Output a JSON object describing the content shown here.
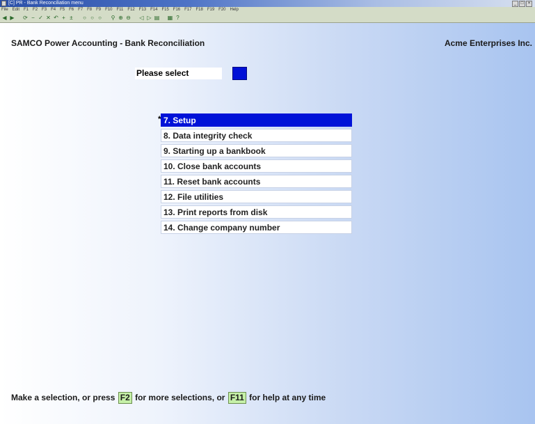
{
  "window": {
    "title": "[C] PR - Bank Reconciliation menu"
  },
  "menubar": {
    "items": [
      "File",
      "Edit",
      "F1",
      "F2",
      "F3",
      "F4",
      "F5",
      "F6",
      "F7",
      "F8",
      "F9",
      "F10",
      "F11",
      "F12",
      "F13",
      "F14",
      "F15",
      "F16",
      "F17",
      "F18",
      "F19",
      "F20",
      "Help"
    ]
  },
  "app": {
    "title": "SAMCO Power Accounting - Bank Reconciliation",
    "company": "Acme Enterprises Inc."
  },
  "prompt": {
    "label": "Please select",
    "value": ""
  },
  "menu": {
    "marker": "*",
    "items": [
      {
        "label": "7. Setup",
        "selected": true
      },
      {
        "label": "8. Data integrity check",
        "selected": false
      },
      {
        "label": "9. Starting up a bankbook",
        "selected": false
      },
      {
        "label": "10. Close bank accounts",
        "selected": false
      },
      {
        "label": "11. Reset bank accounts",
        "selected": false
      },
      {
        "label": "12. File utilities",
        "selected": false
      },
      {
        "label": "13. Print reports from disk",
        "selected": false
      },
      {
        "label": "14. Change company number",
        "selected": false
      }
    ]
  },
  "status": {
    "part1": "Make a selection, or press ",
    "key1": "F2",
    "part2": " for more selections, or ",
    "key2": "F11",
    "part3": " for help at any time"
  },
  "colors": {
    "selection": "#0012d8",
    "input": "#0010d6",
    "key_highlight": "#c5f0a8"
  }
}
